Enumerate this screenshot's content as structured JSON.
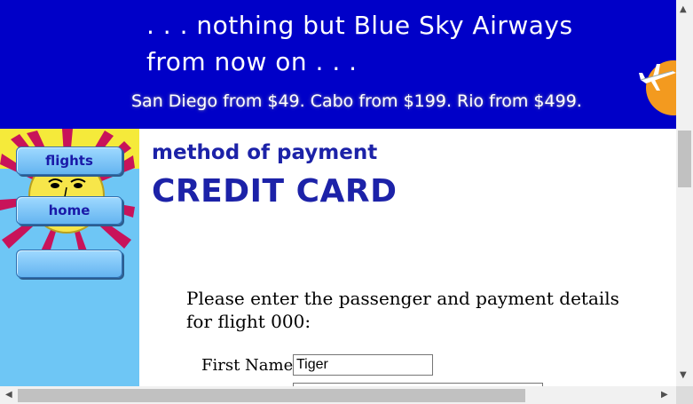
{
  "banner": {
    "line1": ". . . nothing but Blue Sky Airways",
    "line2": "from now on . . .",
    "promo": "San Diego from $49. Cabo from $199. Rio from $499.",
    "colors": {
      "background": "#0000c8",
      "text": "#ffffff",
      "sun": "#f39a1f"
    }
  },
  "sidebar": {
    "background": "#6ec6f5",
    "nav": [
      {
        "label": "flights"
      },
      {
        "label": "home"
      },
      {
        "label": ""
      }
    ]
  },
  "main": {
    "method_title": "method of payment",
    "card_title": "CREDIT CARD",
    "intro": "Please enter the passenger and payment details for flight 000:",
    "fields": {
      "first_name": {
        "label": "First Name :",
        "value": "Tiger"
      },
      "last_name": {
        "label": "",
        "value": ""
      }
    },
    "accent_color": "#1c22a8"
  },
  "icons": {
    "sun": "sun-face-icon",
    "plane": "airplane-icon",
    "scroll_up": "arrow-up-icon",
    "scroll_down": "arrow-down-icon",
    "scroll_left": "arrow-left-icon",
    "scroll_right": "arrow-right-icon"
  }
}
